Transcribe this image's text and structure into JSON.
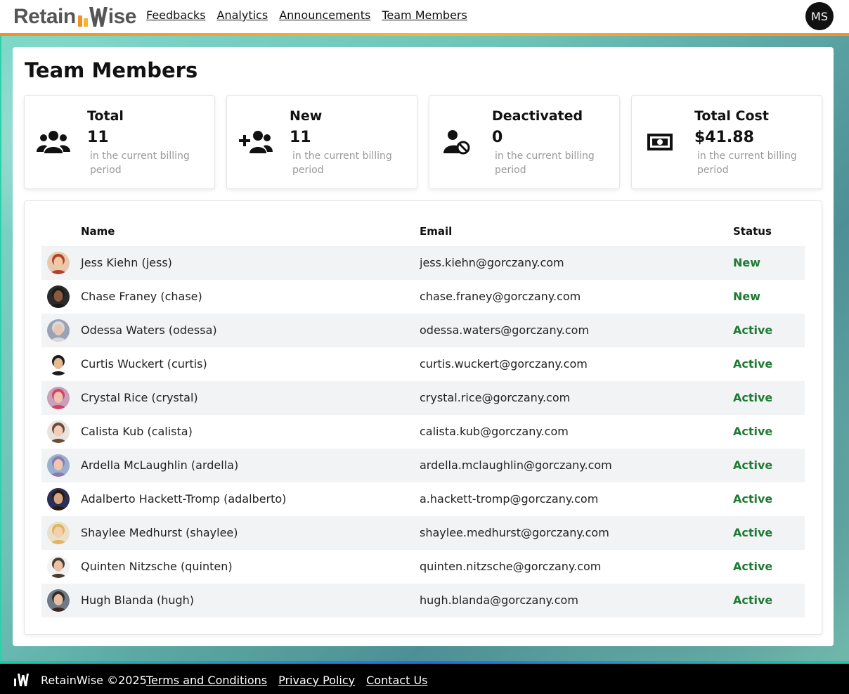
{
  "brand": {
    "name_left": "Retain",
    "name_right": "ise",
    "accent_orange": "#f4902c",
    "accent_yellow": "#f6b533",
    "accent_green": "#2bd1a8"
  },
  "nav": [
    {
      "label": "Feedbacks"
    },
    {
      "label": "Analytics"
    },
    {
      "label": "Announcements"
    },
    {
      "label": "Team Members"
    }
  ],
  "user": {
    "initials": "MS"
  },
  "page": {
    "title": "Team Members"
  },
  "stats": [
    {
      "title": "Total",
      "value": "11",
      "sub": "in the current billing period",
      "icon": "users-icon"
    },
    {
      "title": "New",
      "value": "11",
      "sub": "in the current billing period",
      "icon": "user-plus-icon"
    },
    {
      "title": "Deactivated",
      "value": "0",
      "sub": "in the current billing period",
      "icon": "user-slash-icon"
    },
    {
      "title": "Total Cost",
      "value": "$41.88",
      "sub": "in the current billing period",
      "icon": "money-bill-icon"
    }
  ],
  "table": {
    "columns": {
      "name": "Name",
      "email": "Email",
      "status": "Status"
    },
    "status_color": "#1e7a34",
    "rows": [
      {
        "name": "Jess Kiehn (jess)",
        "email": "jess.kiehn@gorczany.com",
        "status": "New",
        "avatar": {
          "bg": "#e8c9b0",
          "face": "#f1c7a4",
          "hair": "#b0432b"
        }
      },
      {
        "name": "Chase Franey (chase)",
        "email": "chase.franey@gorczany.com",
        "status": "New",
        "avatar": {
          "bg": "#2a2a2a",
          "face": "#8a5a3c",
          "hair": "#1a1a1a"
        }
      },
      {
        "name": "Odessa Waters (odessa)",
        "email": "odessa.waters@gorczany.com",
        "status": "Active",
        "avatar": {
          "bg": "#9aa3b5",
          "face": "#e9c6b4",
          "hair": "#d9d9d9"
        }
      },
      {
        "name": "Curtis Wuckert (curtis)",
        "email": "curtis.wuckert@gorczany.com",
        "status": "Active",
        "avatar": {
          "bg": "#ffffff",
          "face": "#e6b98e",
          "hair": "#1c1c1c"
        }
      },
      {
        "name": "Crystal Rice (crystal)",
        "email": "crystal.rice@gorczany.com",
        "status": "Active",
        "avatar": {
          "bg": "#c8a0b8",
          "face": "#efc3b0",
          "hair": "#d8406a"
        }
      },
      {
        "name": "Calista Kub (calista)",
        "email": "calista.kub@gorczany.com",
        "status": "Active",
        "avatar": {
          "bg": "#e9e3df",
          "face": "#f1cdb7",
          "hair": "#6b4a3a"
        }
      },
      {
        "name": "Ardella McLaughlin (ardella)",
        "email": "ardella.mclaughlin@gorczany.com",
        "status": "Active",
        "avatar": {
          "bg": "#9ab0d0",
          "face": "#eec7b0",
          "hair": "#8a7ab0"
        }
      },
      {
        "name": "Adalberto Hackett-Tromp (adalberto)",
        "email": "a.hackett-tromp@gorczany.com",
        "status": "Active",
        "avatar": {
          "bg": "#2b2f55",
          "face": "#d6a584",
          "hair": "#2a1a10"
        }
      },
      {
        "name": "Shaylee Medhurst (shaylee)",
        "email": "shaylee.medhurst@gorczany.com",
        "status": "Active",
        "avatar": {
          "bg": "#eadfc8",
          "face": "#f3cfae",
          "hair": "#e0b560"
        }
      },
      {
        "name": "Quinten Nitzsche (quinten)",
        "email": "quinten.nitzsche@gorczany.com",
        "status": "Active",
        "avatar": {
          "bg": "#f2f2f2",
          "face": "#e8c2a6",
          "hair": "#4a3a30"
        }
      },
      {
        "name": "Hugh Blanda (hugh)",
        "email": "hugh.blanda@gorczany.com",
        "status": "Active",
        "avatar": {
          "bg": "#6e7a86",
          "face": "#e6bfa2",
          "hair": "#3a2a20"
        }
      }
    ]
  },
  "footer": {
    "copyright": "RetainWise ©2025",
    "links": [
      {
        "label": "Terms and Conditions"
      },
      {
        "label": "Privacy Policy"
      },
      {
        "label": "Contact Us"
      }
    ]
  }
}
